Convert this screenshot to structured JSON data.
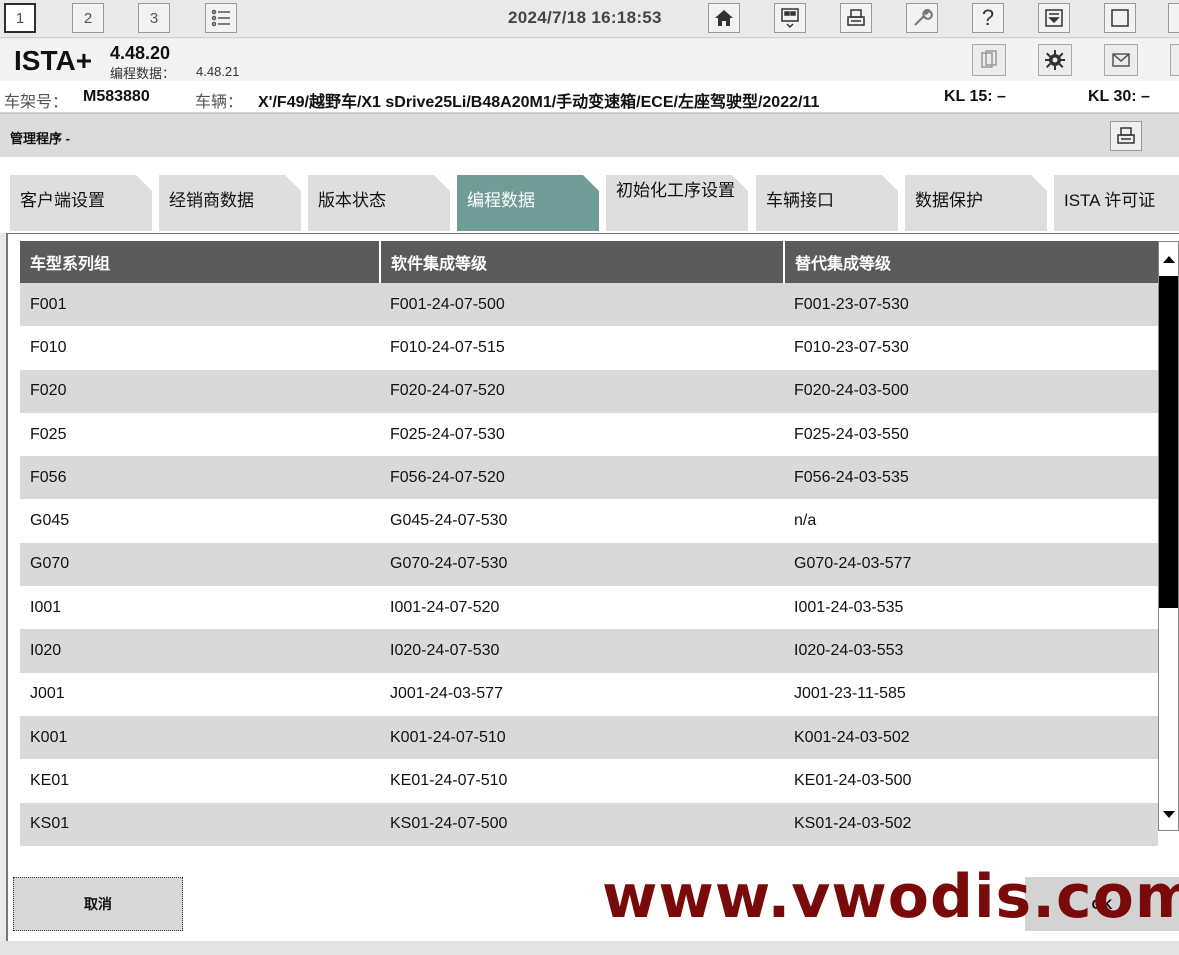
{
  "toolbar": {
    "window_buttons": [
      "1",
      "2",
      "3"
    ],
    "datetime": "2024/7/18 16:18:53",
    "help_label": "?"
  },
  "app": {
    "name": "ISTA+",
    "version": "4.48.20",
    "programming_data_label": "编程数据：",
    "programming_data_version": "4.48.21"
  },
  "vehicle": {
    "vin_label": "车架号：",
    "vin": "M583880",
    "vehicle_label": "车辆：",
    "vehicle_desc": "X'/F49/越野车/X1 sDrive25Li/B48A20M1/手动变速箱/ECE/左座驾驶型/2022/11",
    "kl15": "KL 15: –",
    "kl30": "KL 30: –"
  },
  "admin": {
    "title": "管理程序 -"
  },
  "tabs": [
    {
      "label": "客户端设置"
    },
    {
      "label": "经销商数据"
    },
    {
      "label": "版本状态"
    },
    {
      "label": "编程数据"
    },
    {
      "label": "初始化工序设置"
    },
    {
      "label": "车辆接口"
    },
    {
      "label": "数据保护"
    },
    {
      "label": "ISTA 许可证"
    }
  ],
  "active_tab": "编程数据",
  "table": {
    "columns": [
      "车型系列组",
      "软件集成等级",
      "替代集成等级"
    ],
    "rows": [
      [
        "F001",
        "F001-24-07-500",
        "F001-23-07-530"
      ],
      [
        "F010",
        "F010-24-07-515",
        "F010-23-07-530"
      ],
      [
        "F020",
        "F020-24-07-520",
        "F020-24-03-500"
      ],
      [
        "F025",
        "F025-24-07-530",
        "F025-24-03-550"
      ],
      [
        "F056",
        "F056-24-07-520",
        "F056-24-03-535"
      ],
      [
        "G045",
        "G045-24-07-530",
        "n/a"
      ],
      [
        "G070",
        "G070-24-07-530",
        "G070-24-03-577"
      ],
      [
        "I001",
        "I001-24-07-520",
        "I001-24-03-535"
      ],
      [
        "I020",
        "I020-24-07-530",
        "I020-24-03-553"
      ],
      [
        "J001",
        "J001-24-03-577",
        "J001-23-11-585"
      ],
      [
        "K001",
        "K001-24-07-510",
        "K001-24-03-502"
      ],
      [
        "KE01",
        "KE01-24-07-510",
        "KE01-24-03-500"
      ],
      [
        "KS01",
        "KS01-24-07-500",
        "KS01-24-03-502"
      ]
    ]
  },
  "buttons": {
    "cancel": "取消",
    "ok": "OK"
  },
  "watermark": "www.vwodis.com",
  "colors": {
    "active_tab": "#6f9c97",
    "header_bg": "#5b5b5b",
    "stripe": "#d9d9d9",
    "watermark": "#7a0a0a"
  }
}
